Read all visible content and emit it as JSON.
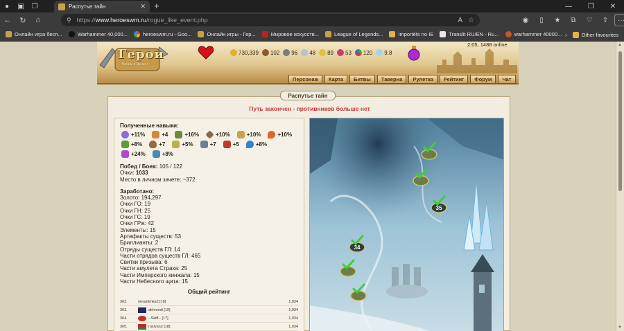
{
  "browser": {
    "tab_title": "Распутье тайн",
    "url_prefix": "https://",
    "url_host": "www.heroeswm.ru",
    "url_path": "/rogue_like_event.php",
    "bookmarks": [
      "Онлайн игра бесп...",
      "Warhammer 40,000...",
      "heroeswm.ru - Goo...",
      "Онлайн игры - Гер...",
      "Мировое искусств...",
      "League of Legends...",
      "Importéts no IE",
      "Translit RU/EN - Ru...",
      "warhammer 40000..."
    ],
    "other_favourites": "Other favourites"
  },
  "header": {
    "logo_text": "Герои",
    "logo_sub": "Войны и Деньги",
    "resources": [
      {
        "icon": "gold-icon",
        "value": "730,339"
      },
      {
        "icon": "wood-icon",
        "value": "102"
      },
      {
        "icon": "ore-icon",
        "value": "96"
      },
      {
        "icon": "mercury-icon",
        "value": "48"
      },
      {
        "icon": "sulfur-icon",
        "value": "89"
      },
      {
        "icon": "crystal-icon",
        "value": "53"
      },
      {
        "icon": "gems-icon",
        "value": "120"
      },
      {
        "icon": "diamond-icon",
        "value": "9.8"
      }
    ],
    "online": "2:05, 1488 online",
    "menu": [
      "Персонаж",
      "Карта",
      "Битвы",
      "Таверна",
      "Рулетка",
      "Рейтинг",
      "Форум",
      "Чат"
    ]
  },
  "panel": {
    "title": "Распутье тайн",
    "status": "Путь закончен - противников больше нет"
  },
  "stats": {
    "skills_title": "Полученные навыки:",
    "skills": [
      {
        "icon": "magic-orb-icon",
        "value": "+11%",
        "color": "#8a6fd1"
      },
      {
        "icon": "wand-icon",
        "value": "+4",
        "color": "#d08a3a"
      },
      {
        "icon": "sword-icon",
        "value": "+16%",
        "color": "#6a8c3a"
      },
      {
        "icon": "armor-icon",
        "value": "+10%",
        "color": "#8c6a46"
      },
      {
        "icon": "scroll-icon",
        "value": "+10%",
        "color": "#c9a24a"
      },
      {
        "icon": "fire-icon",
        "value": "+10%",
        "color": "#e1652a"
      },
      {
        "icon": "nature-icon",
        "value": "+8%",
        "color": "#5e9a3a"
      },
      {
        "icon": "shield-icon",
        "value": "+7",
        "color": "#9a6a3a"
      },
      {
        "icon": "lightning-icon",
        "value": "+5%",
        "color": "#b8b04a"
      },
      {
        "icon": "blades-icon",
        "value": "+7",
        "color": "#6f7f8f"
      },
      {
        "icon": "book-icon",
        "value": "+5",
        "color": "#c0392b"
      },
      {
        "icon": "water-icon",
        "value": "+8%",
        "color": "#3a7fd1"
      },
      {
        "icon": "arcane-icon",
        "value": "+24%",
        "color": "#b04ac9"
      },
      {
        "icon": "bow-icon",
        "value": "+8%",
        "color": "#4a8ab0"
      }
    ],
    "wins_label": "Побед / Боев:",
    "wins_value": "105 / 122",
    "points_label": "Очки:",
    "points_value": "1033",
    "place": "Место в личном зачете: ~372",
    "earned_title": "Заработано:",
    "earned": [
      "Золото: 194,297",
      "Очки ГО: 19",
      "Очки ГН: 25",
      "Очки ГС: 19",
      "Очки ГРж: 42",
      "Элементы: 15",
      "Артефакты существ: 53",
      "Бриллианты: 2",
      "Отряды существ ГЛ: 14",
      "Части отрядов существ ГЛ: 465",
      "Свитки призыва: 6",
      "Части амулета Страха: 25",
      "Части Имперского кинжала: 15",
      "Части Небесного щита: 15"
    ],
    "rating_title": "Общий рейтинг",
    "rating": [
      {
        "pos": "362.",
        "name": "nevadimka2 [18]",
        "score": "1,034"
      },
      {
        "pos": "363.",
        "name": "akhmedi [19]",
        "score": "1,034"
      },
      {
        "pos": "364.",
        "name": "--Skiff-- [17]",
        "score": "1,034"
      },
      {
        "pos": "365.",
        "name": "rusivan2 [18]",
        "score": "1,034"
      }
    ]
  },
  "map": {
    "nodes": [
      {
        "label": ""
      },
      {
        "label": ""
      },
      {
        "label": "35"
      },
      {
        "label": "34"
      },
      {
        "label": ""
      },
      {
        "label": ""
      }
    ]
  }
}
